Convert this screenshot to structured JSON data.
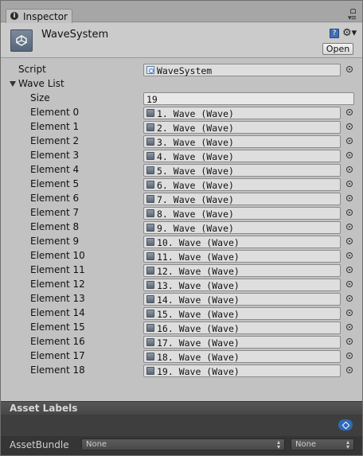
{
  "tab": {
    "title": "Inspector",
    "info_glyph": "i"
  },
  "header": {
    "object_name": "WaveSystem",
    "open_label": "Open",
    "help_glyph": "?"
  },
  "script_row": {
    "label": "Script",
    "value": "WaveSystem"
  },
  "wave_list": {
    "label": "Wave List",
    "size_label": "Size",
    "size_value": "19",
    "elements": [
      {
        "label": "Element 0",
        "value": "1. Wave (Wave)"
      },
      {
        "label": "Element 1",
        "value": "2. Wave (Wave)"
      },
      {
        "label": "Element 2",
        "value": "3. Wave (Wave)"
      },
      {
        "label": "Element 3",
        "value": "4. Wave (Wave)"
      },
      {
        "label": "Element 4",
        "value": "5. Wave (Wave)"
      },
      {
        "label": "Element 5",
        "value": "6. Wave (Wave)"
      },
      {
        "label": "Element 6",
        "value": "7. Wave (Wave)"
      },
      {
        "label": "Element 7",
        "value": "8. Wave (Wave)"
      },
      {
        "label": "Element 8",
        "value": "9. Wave (Wave)"
      },
      {
        "label": "Element 9",
        "value": "10. Wave (Wave)"
      },
      {
        "label": "Element 10",
        "value": "11. Wave (Wave)"
      },
      {
        "label": "Element 11",
        "value": "12. Wave (Wave)"
      },
      {
        "label": "Element 12",
        "value": "13. Wave (Wave)"
      },
      {
        "label": "Element 13",
        "value": "14. Wave (Wave)"
      },
      {
        "label": "Element 14",
        "value": "15. Wave (Wave)"
      },
      {
        "label": "Element 15",
        "value": "16. Wave (Wave)"
      },
      {
        "label": "Element 16",
        "value": "17. Wave (Wave)"
      },
      {
        "label": "Element 17",
        "value": "18. Wave (Wave)"
      },
      {
        "label": "Element 18",
        "value": "19. Wave (Wave)"
      }
    ]
  },
  "asset_labels": {
    "title": "Asset Labels",
    "bundle_label": "AssetBundle",
    "bundle_name": "None",
    "bundle_variant": "None"
  },
  "icons": {
    "tab": "info-icon",
    "object": "unity-logo-icon",
    "help": "help-icon",
    "settings": "gear-icon",
    "element": "scriptable-object-icon",
    "script": "script-icon",
    "picker": "object-picker-icon",
    "tag": "tag-icon"
  },
  "colors": {
    "panel_bg": "#c2c2c2",
    "field_bg": "#dedede",
    "asset_labels_bar": "#4f4f4f",
    "tag_blue": "#2e6ab7"
  }
}
